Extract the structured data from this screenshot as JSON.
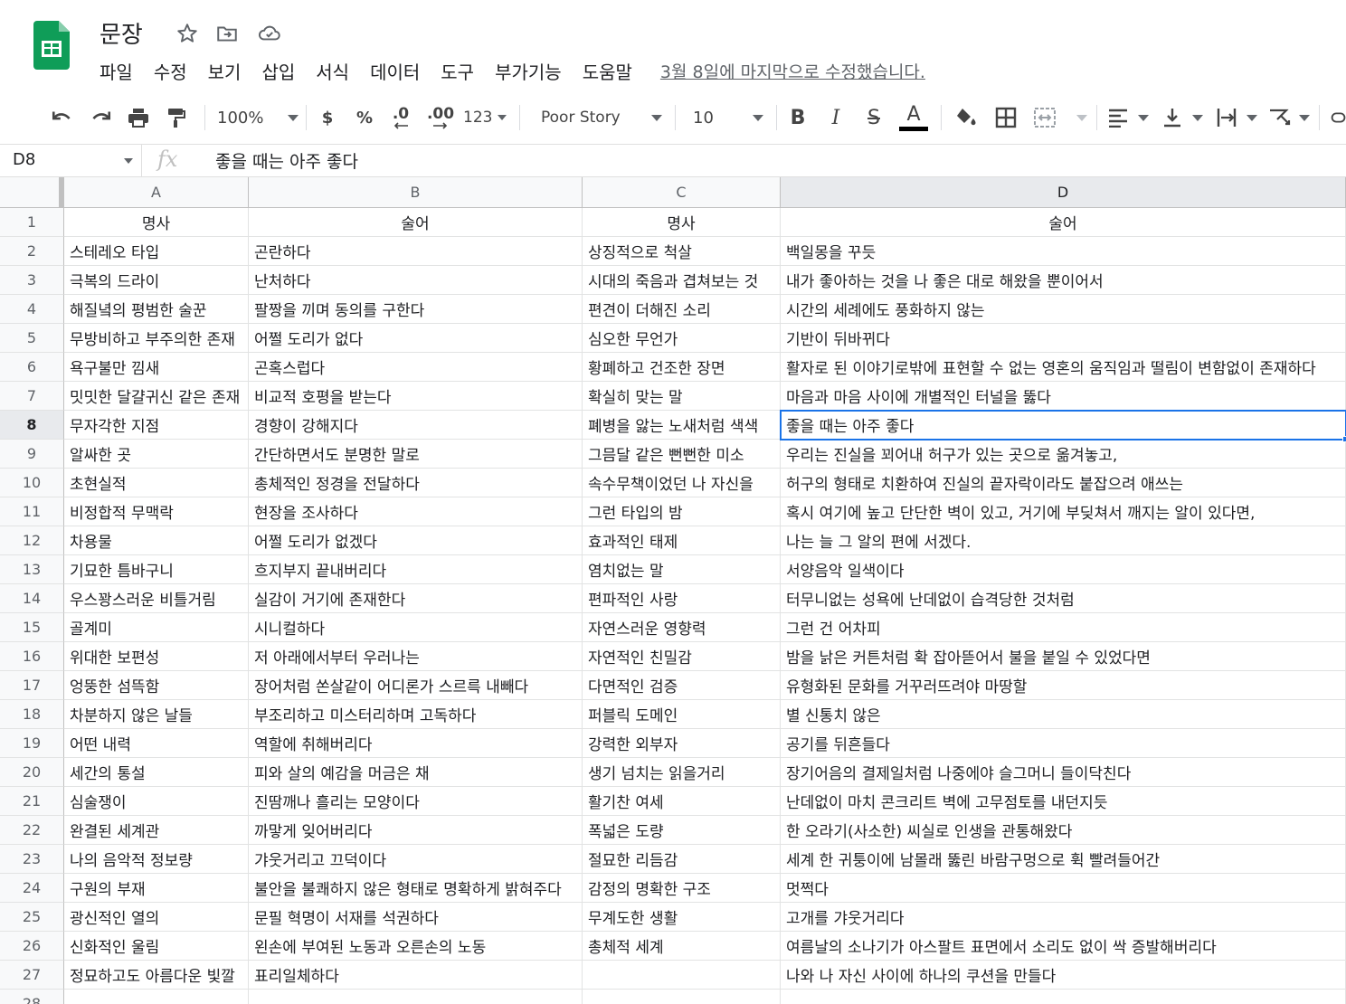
{
  "app": {
    "doc_title": "문장",
    "last_edit": "3월 8일에 마지막으로 수정했습니다.",
    "brand_color": "#0f9d58",
    "menu": [
      "파일",
      "수정",
      "보기",
      "삽입",
      "서식",
      "데이터",
      "도구",
      "부가기능",
      "도움말"
    ]
  },
  "toolbar": {
    "zoom": "100%",
    "currency": "$",
    "percent": "%",
    "decrease_decimal": ".0",
    "increase_decimal": ".00",
    "more_formats": "123",
    "font": "Poor Story",
    "font_size": "10",
    "bold": "B",
    "italic": "I",
    "strikethrough": "S",
    "text_color": "A",
    "icons": [
      "undo-icon",
      "redo-icon",
      "print-icon",
      "paint-format-icon",
      "fill-color-icon",
      "borders-icon",
      "merge-cells-icon",
      "align-left-icon",
      "valign-bottom-icon",
      "text-wrap-icon",
      "text-rotate-icon"
    ]
  },
  "formula_bar": {
    "cell_ref": "D8",
    "fx": "fx",
    "value": "좋을 때는 아주 좋다"
  },
  "grid": {
    "columns": [
      "A",
      "B",
      "C",
      "D"
    ],
    "selected_column": "D",
    "selected_row": "8",
    "rows": [
      {
        "n": "1",
        "cells": [
          "명사",
          "술어",
          "명사",
          "술어"
        ]
      },
      {
        "n": "2",
        "cells": [
          "스테레오 타입",
          "곤란하다",
          "상징적으로 척살",
          "백일몽을 꾸듯"
        ]
      },
      {
        "n": "3",
        "cells": [
          "극복의 드라이",
          "난처하다",
          "시대의 죽음과 겹쳐보는 것",
          "내가 좋아하는 것을 나 좋은 대로 해왔을 뿐이어서"
        ]
      },
      {
        "n": "4",
        "cells": [
          "해질녘의 평범한 술꾼",
          "팔짱을 끼며 동의를 구한다",
          "편견이 더해진 소리",
          "시간의 세례에도 풍화하지 않는"
        ]
      },
      {
        "n": "5",
        "cells": [
          "무방비하고 부주의한 존재",
          "어쩔 도리가 없다",
          "심오한 무언가",
          "기반이 뒤바뀌다"
        ]
      },
      {
        "n": "6",
        "cells": [
          "욕구불만 낌새",
          "곤혹스럽다",
          "황폐하고 건조한 장면",
          "활자로 된 이야기로밖에 표현할 수 없는 영혼의 움직임과 떨림이 변함없이 존재하다"
        ]
      },
      {
        "n": "7",
        "cells": [
          "밋밋한 달걀귀신 같은 존재",
          "비교적 호평을 받는다",
          "확실히 맞는 말",
          "마음과 마음 사이에 개별적인 터널을 뚫다"
        ]
      },
      {
        "n": "8",
        "cells": [
          "무자각한 지점",
          "경향이 강해지다",
          "폐병을 앓는 노새처럼 색색",
          "좋을 때는 아주 좋다"
        ]
      },
      {
        "n": "9",
        "cells": [
          "알싸한 곳",
          "간단하면서도 분명한 말로",
          "그믐달 같은 뻔뻔한 미소",
          "우리는 진실을 꾀어내 허구가 있는 곳으로 옮겨놓고,"
        ]
      },
      {
        "n": "10",
        "cells": [
          "초현실적",
          "총체적인 정경을 전달하다",
          "속수무책이었던 나 자신을",
          "허구의 형태로 치환하여 진실의 끝자락이라도 붙잡으려 애쓰는"
        ]
      },
      {
        "n": "11",
        "cells": [
          "비정합적 무맥락",
          "현장을 조사하다",
          "그런 타입의 밤",
          "혹시 여기에 높고 단단한 벽이 있고, 거기에 부딪쳐서 깨지는 알이 있다면,"
        ]
      },
      {
        "n": "12",
        "cells": [
          "차용물",
          "어쩔 도리가 없겠다",
          "효과적인 태제",
          "나는 늘 그 알의 편에 서겠다."
        ]
      },
      {
        "n": "13",
        "cells": [
          "기묘한 틈바구니",
          "흐지부지 끝내버리다",
          "염치없는 말",
          "서양음악 일색이다"
        ]
      },
      {
        "n": "14",
        "cells": [
          "우스꽝스러운 비틀거림",
          "실감이 거기에 존재한다",
          "편파적인 사랑",
          "터무니없는 성욕에 난데없이 습격당한 것처럼"
        ]
      },
      {
        "n": "15",
        "cells": [
          "골계미",
          "시니컬하다",
          "자연스러운 영향력",
          "그런 건 어차피"
        ]
      },
      {
        "n": "16",
        "cells": [
          "위대한 보편성",
          "저 아래에서부터 우러나는",
          "자연적인 친밀감",
          "밤을 낡은 커튼처럼 확 잡아뜯어서 불을 붙일 수 있었다면"
        ]
      },
      {
        "n": "17",
        "cells": [
          "엉뚱한 섬뜩함",
          "장어처럼 쏜살같이 어디론가 스르륵 내빼다",
          "다면적인 검증",
          "유형화된 문화를 거꾸러뜨려야 마땅할"
        ]
      },
      {
        "n": "18",
        "cells": [
          "차분하지 않은 날들",
          "부조리하고 미스터리하며 고독하다",
          "퍼블릭 도메인",
          "별 신통치 않은"
        ]
      },
      {
        "n": "19",
        "cells": [
          "어떤 내력",
          "역할에 취해버리다",
          "강력한 외부자",
          "공기를 뒤흔들다"
        ]
      },
      {
        "n": "20",
        "cells": [
          "세간의 통설",
          "피와 살의 예감을 머금은 채",
          "생기 넘치는 읽을거리",
          "장기어음의 결제일처럼 나중에야 슬그머니 들이닥친다"
        ]
      },
      {
        "n": "21",
        "cells": [
          "심술쟁이",
          "진땀깨나 흘리는 모양이다",
          "활기찬 여세",
          "난데없이 마치 콘크리트 벽에 고무점토를 내던지듯"
        ]
      },
      {
        "n": "22",
        "cells": [
          "완결된 세계관",
          "까맣게 잊어버리다",
          "폭넓은 도량",
          "한 오라기(사소한) 씨실로 인생을 관통해왔다"
        ]
      },
      {
        "n": "23",
        "cells": [
          "나의 음악적 정보량",
          "갸웃거리고 끄덕이다",
          "절묘한 리듬감",
          "세계 한 귀퉁이에 남몰래 뚫린 바람구멍으로 휙 빨려들어간"
        ]
      },
      {
        "n": "24",
        "cells": [
          "구원의 부재",
          "불안을 불쾌하지 않은 형태로 명확하게 밝혀주다",
          "감정의 명확한 구조",
          "멋쩍다"
        ]
      },
      {
        "n": "25",
        "cells": [
          "광신적인 열의",
          "문필 혁명이 서재를 석권하다",
          "무계도한 생활",
          "고개를 갸웃거리다"
        ]
      },
      {
        "n": "26",
        "cells": [
          "신화적인 울림",
          "왼손에 부여된 노동과 오른손의 노동",
          "총체적 세계",
          "여름날의 소나기가 아스팔트 표면에서 소리도 없이 싹 증발해버리다"
        ]
      },
      {
        "n": "27",
        "cells": [
          "정묘하고도 아름다운 빛깔",
          "표리일체하다",
          "",
          "나와 나 자신 사이에 하나의 쿠션을 만들다"
        ]
      },
      {
        "n": "28",
        "cells": [
          "",
          "",
          "",
          ""
        ]
      }
    ]
  }
}
